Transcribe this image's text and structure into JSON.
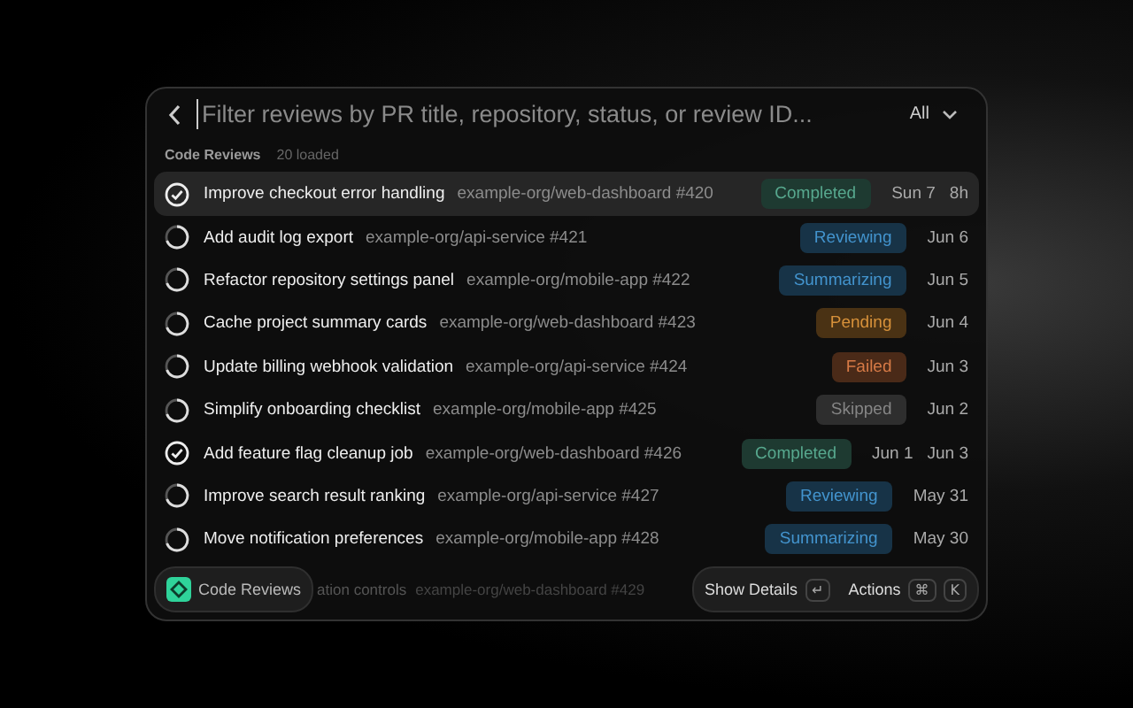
{
  "search": {
    "placeholder": "Filter reviews by PR title, repository, status, or review ID...",
    "filter": "All"
  },
  "section": {
    "title": "Code Reviews",
    "count": "20 loaded"
  },
  "rows": [
    {
      "kind": "done",
      "title": "Improve checkout error handling",
      "repo": "example-org/web-dashboard #420",
      "status": "Completed",
      "color": "#1e3a31",
      "dates": [
        "Sun 7",
        "8h"
      ],
      "selected": true
    },
    {
      "kind": "running",
      "title": "Add audit log export",
      "repo": "example-org/api-service #421",
      "status": "Reviewing",
      "color": "#173347",
      "dates": [
        "Jun 6"
      ],
      "selected": false
    },
    {
      "kind": "running",
      "title": "Refactor repository settings panel",
      "repo": "example-org/mobile-app #422",
      "status": "Summarizing",
      "color": "#173347",
      "dates": [
        "Jun 5"
      ],
      "selected": false
    },
    {
      "kind": "running",
      "title": "Cache project summary cards",
      "repo": "example-org/web-dashboard #423",
      "status": "Pending",
      "color": "#4a3214",
      "dates": [
        "Jun 4"
      ],
      "selected": false
    },
    {
      "kind": "running",
      "title": "Update billing webhook validation",
      "repo": "example-org/api-service #424",
      "status": "Failed",
      "color": "#4a2a18",
      "dates": [
        "Jun 3"
      ],
      "selected": false
    },
    {
      "kind": "running",
      "title": "Simplify onboarding checklist",
      "repo": "example-org/mobile-app #425",
      "status": "Skipped",
      "color": "#2e2e2e",
      "dates": [
        "Jun 2"
      ],
      "selected": false
    },
    {
      "kind": "done",
      "title": "Add feature flag cleanup job",
      "repo": "example-org/web-dashboard #426",
      "status": "Completed",
      "color": "#1e3a31",
      "dates": [
        "Jun 1",
        "Jun 3"
      ],
      "selected": false
    },
    {
      "kind": "running",
      "title": "Improve search result ranking",
      "repo": "example-org/api-service #427",
      "status": "Reviewing",
      "color": "#173347",
      "dates": [
        "May 31"
      ],
      "selected": false
    },
    {
      "kind": "running",
      "title": "Move notification preferences",
      "repo": "example-org/mobile-app #428",
      "status": "Summarizing",
      "color": "#173347",
      "dates": [
        "May 30"
      ],
      "selected": false
    }
  ],
  "footer": {
    "app": "Code Reviews",
    "hidden_row_title": "ation controls",
    "hidden_row_repo": "example-org/web-dashboard #429",
    "primary_action": "Show Details",
    "primary_key": "↵",
    "secondary_action": "Actions",
    "secondary_keys": [
      "⌘",
      "K"
    ]
  }
}
